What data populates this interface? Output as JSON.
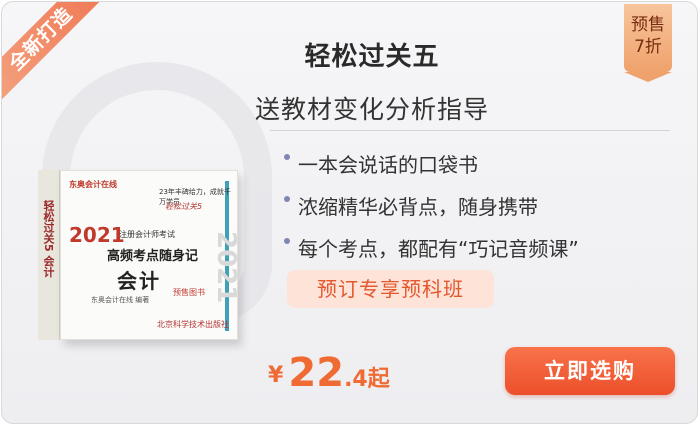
{
  "corner_ribbon": "全新打造",
  "presale_badge": {
    "line1": "预售",
    "line2": "7折"
  },
  "title": "轻松过关五",
  "subtitle": "送教材变化分析指导",
  "features": [
    "一本会说话的口袋书",
    "浓缩精华必背点，随身携带",
    "每个考点，都配有“巧记音频课”"
  ],
  "promo_tag": "预订专享预科班",
  "price": {
    "currency": "¥",
    "integer": "22",
    "decimal": ".4",
    "suffix": "起"
  },
  "buy_button": "立即选购",
  "book": {
    "logo": "东奥会计在线",
    "tagline": "23年丰碑给力，成就千万学员",
    "signature": "轻松过关5",
    "year": "2021",
    "exam": "注册会计师考试",
    "title": "高频考点随身记",
    "subject": "会计",
    "presale": "预售图书",
    "author": "东奥会计在线 编著",
    "watermark": "2021",
    "publisher": "北京科学技术出版社",
    "spine": "轻松过关5 会计"
  },
  "colors": {
    "accent": "#f06a33",
    "button": "#ec4f2a",
    "promo_bg": "#fde3d8",
    "bullet_dot": "#7f86b5"
  }
}
